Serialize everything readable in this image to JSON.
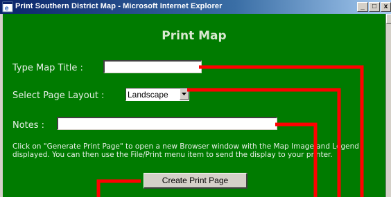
{
  "window": {
    "title": "Print Southern District Map - Microsoft Internet Explorer",
    "controls": {
      "minimize": "_",
      "maximize": "□",
      "close": "x"
    }
  },
  "page": {
    "title": "Print Map",
    "background_color": "#007b00"
  },
  "form": {
    "map_title": {
      "label": "Type Map Title :",
      "value": ""
    },
    "page_layout": {
      "label": "Select Page Layout :",
      "selected": "Landscape"
    },
    "notes": {
      "label": "Notes :",
      "value": ""
    }
  },
  "instructions": "Click on \"Generate Print Page\" to open a new Browser window with the Map Image and Legend displayed. You can then use the File/Print menu item to send the display to your printer.",
  "button": {
    "label": "Create Print Page"
  },
  "annotation": {
    "line_color": "#ff0000"
  }
}
